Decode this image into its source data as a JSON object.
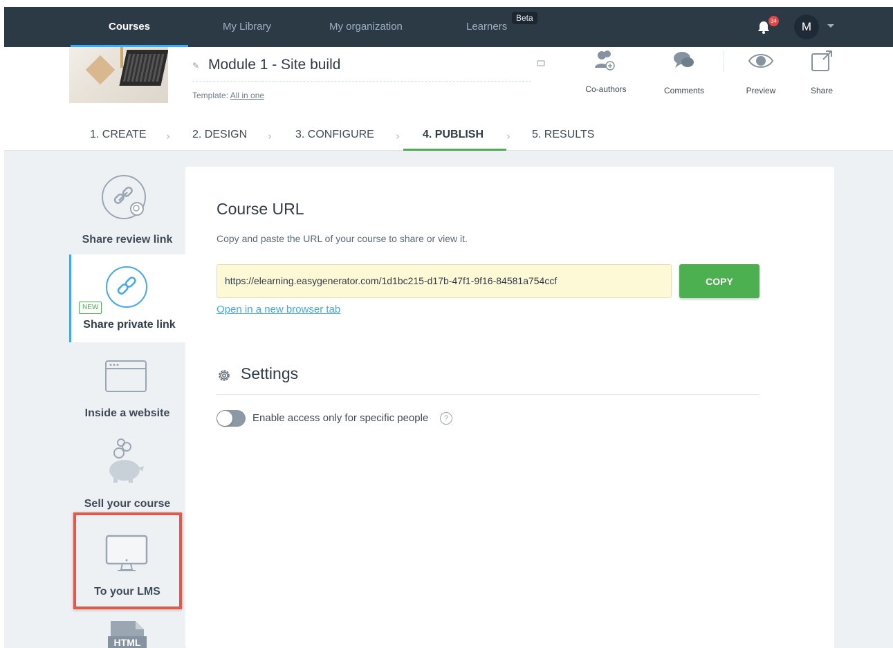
{
  "nav": {
    "items": [
      {
        "label": "Courses",
        "active": true
      },
      {
        "label": "My Library",
        "active": false
      },
      {
        "label": "My organization",
        "active": false
      },
      {
        "label": "Learners",
        "active": false
      }
    ],
    "beta_badge": "Beta",
    "notification_count": "34",
    "avatar_initial": "M"
  },
  "header": {
    "course_title": "Module 1 - Site build",
    "template_prefix": "Template: ",
    "template_name": "All in one",
    "actions": [
      {
        "label": "Co-authors",
        "icon": "co-authors-icon"
      },
      {
        "label": "Comments",
        "icon": "comments-icon"
      },
      {
        "label": "Preview",
        "icon": "eye-icon"
      },
      {
        "label": "Share",
        "icon": "share-icon"
      }
    ]
  },
  "steps": [
    {
      "label": "1. CREATE",
      "active": false
    },
    {
      "label": "2. DESIGN",
      "active": false
    },
    {
      "label": "3. CONFIGURE",
      "active": false
    },
    {
      "label": "4. PUBLISH",
      "active": true
    },
    {
      "label": "5. RESULTS",
      "active": false
    }
  ],
  "sidebar": {
    "items": [
      {
        "label": "Share review link",
        "icon": "review-link-icon"
      },
      {
        "label": "Share private link",
        "icon": "link-icon",
        "active": true
      },
      {
        "label": "Inside a website",
        "icon": "browser-window-icon"
      },
      {
        "label": "Sell your course",
        "icon": "piggy-bank-icon",
        "badge": "NEW"
      },
      {
        "label": "To your LMS",
        "icon": "monitor-icon",
        "highlighted": true
      },
      {
        "label": "",
        "icon": "html-file-icon"
      }
    ],
    "html_icon_text": "HTML"
  },
  "main": {
    "heading": "Course URL",
    "description": "Copy and paste the URL of your course to share or view it.",
    "url_value": "https://elearning.easygenerator.com/1d1bc215-d17b-47f1-9f16-84581a754ccf",
    "copy_label": "COPY",
    "open_link_label": "Open in a new browser tab",
    "settings_heading": "Settings",
    "toggle_label": "Enable access only for specific people",
    "toggle_on": false,
    "help_glyph": "?"
  },
  "colors": {
    "nav_bg": "#2c3a46",
    "accent_blue": "#3fa9f5",
    "accent_green": "#4caf50",
    "highlight_red": "#e4584a",
    "url_bg": "#fdf9d6"
  }
}
